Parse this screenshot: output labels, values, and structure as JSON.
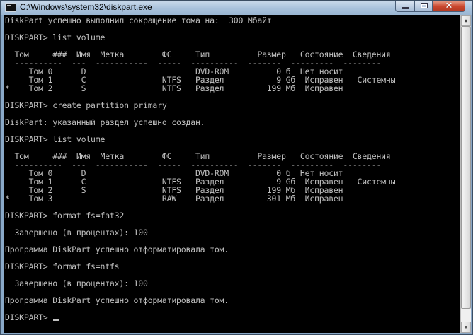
{
  "window": {
    "title": "C:\\Windows\\system32\\diskpart.exe",
    "buttons": {
      "minimize": "minimize",
      "maximize": "maximize",
      "close": "✕"
    }
  },
  "console": {
    "lines": [
      "DiskPart успешно выполнил сокращение тома на:  300 Мбайт",
      "",
      "DISKPART> list volume",
      "",
      "  Том     ###  Имя  Метка        ФС     Тип          Размер   Состояние  Сведения",
      "  ----------  ---  -----------  -----  ----------  -------  ---------  --------",
      "     Том 0      D                       DVD-ROM          0 б  Нет носит",
      "     Том 1      C                NTFS   Раздел           9 Gб  Исправен   Системны",
      "*    Том 2      S                NTFS   Раздел         199 Мб  Исправен",
      "",
      "DISKPART> create partition primary",
      "",
      "DiskPart: указанный раздел успешно создан.",
      "",
      "DISKPART> list volume",
      "",
      "  Том     ###  Имя  Метка        ФС     Тип          Размер   Состояние  Сведения",
      "  ----------  ---  -----------  -----  ----------  -------  ---------  --------",
      "     Том 0      D                       DVD-ROM          0 б  Нет носит",
      "     Том 1      C                NTFS   Раздел           9 Gб  Исправен   Системны",
      "     Том 2      S                NTFS   Раздел         199 Мб  Исправен",
      "*    Том 3                       RAW    Раздел         301 Мб  Исправен",
      "",
      "DISKPART> format fs=fat32",
      "",
      "  Завершено (в процентах): 100",
      "",
      "Программа DiskPart успешно отформатировала том.",
      "",
      "DISKPART> format fs=ntfs",
      "",
      "  Завершено (в процентах): 100",
      "",
      "Программа DiskPart успешно отформатировала том.",
      "",
      "DISKPART> "
    ]
  },
  "colors": {
    "console_bg": "#000000",
    "console_text": "#c0c0c0",
    "close_button": "#c9462d"
  }
}
